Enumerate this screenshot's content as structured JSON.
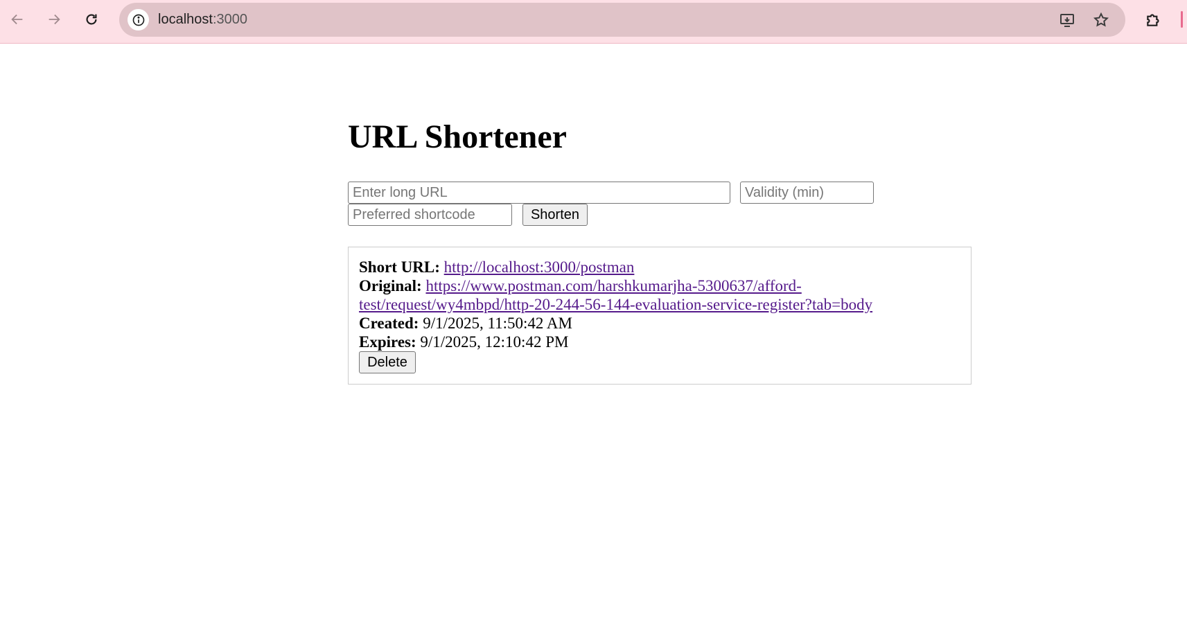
{
  "browser": {
    "url_host": "localhost",
    "url_port": ":3000"
  },
  "page": {
    "title": "URL Shortener"
  },
  "form": {
    "long_url_placeholder": "Enter long URL",
    "validity_placeholder": "Validity (min)",
    "shortcode_placeholder": "Preferred shortcode",
    "shorten_label": "Shorten"
  },
  "result": {
    "short_url_label": "Short URL:",
    "short_url": "http://localhost:3000/postman",
    "original_label": "Original:",
    "original_line1": "https://www.postman.com/harshkumarjha-5300637/afford-",
    "original_line2": "test/request/wy4mbpd/http-20-244-56-144-evaluation-service-register?tab=body",
    "created_label": "Created:",
    "created_value": "9/1/2025, 11:50:42 AM",
    "expires_label": "Expires:",
    "expires_value": "9/1/2025, 12:10:42 PM",
    "delete_label": "Delete"
  },
  "icons": {
    "back": "arrow-left-icon",
    "forward": "arrow-right-icon",
    "reload": "reload-icon",
    "site_info": "info-icon",
    "install": "install-app-icon",
    "bookmark": "star-icon",
    "extensions": "puzzle-icon"
  },
  "colors": {
    "toolbar_bg": "#fde0e6",
    "omnibox_bg": "#e0c3c8",
    "link_visited": "#551a8b"
  }
}
